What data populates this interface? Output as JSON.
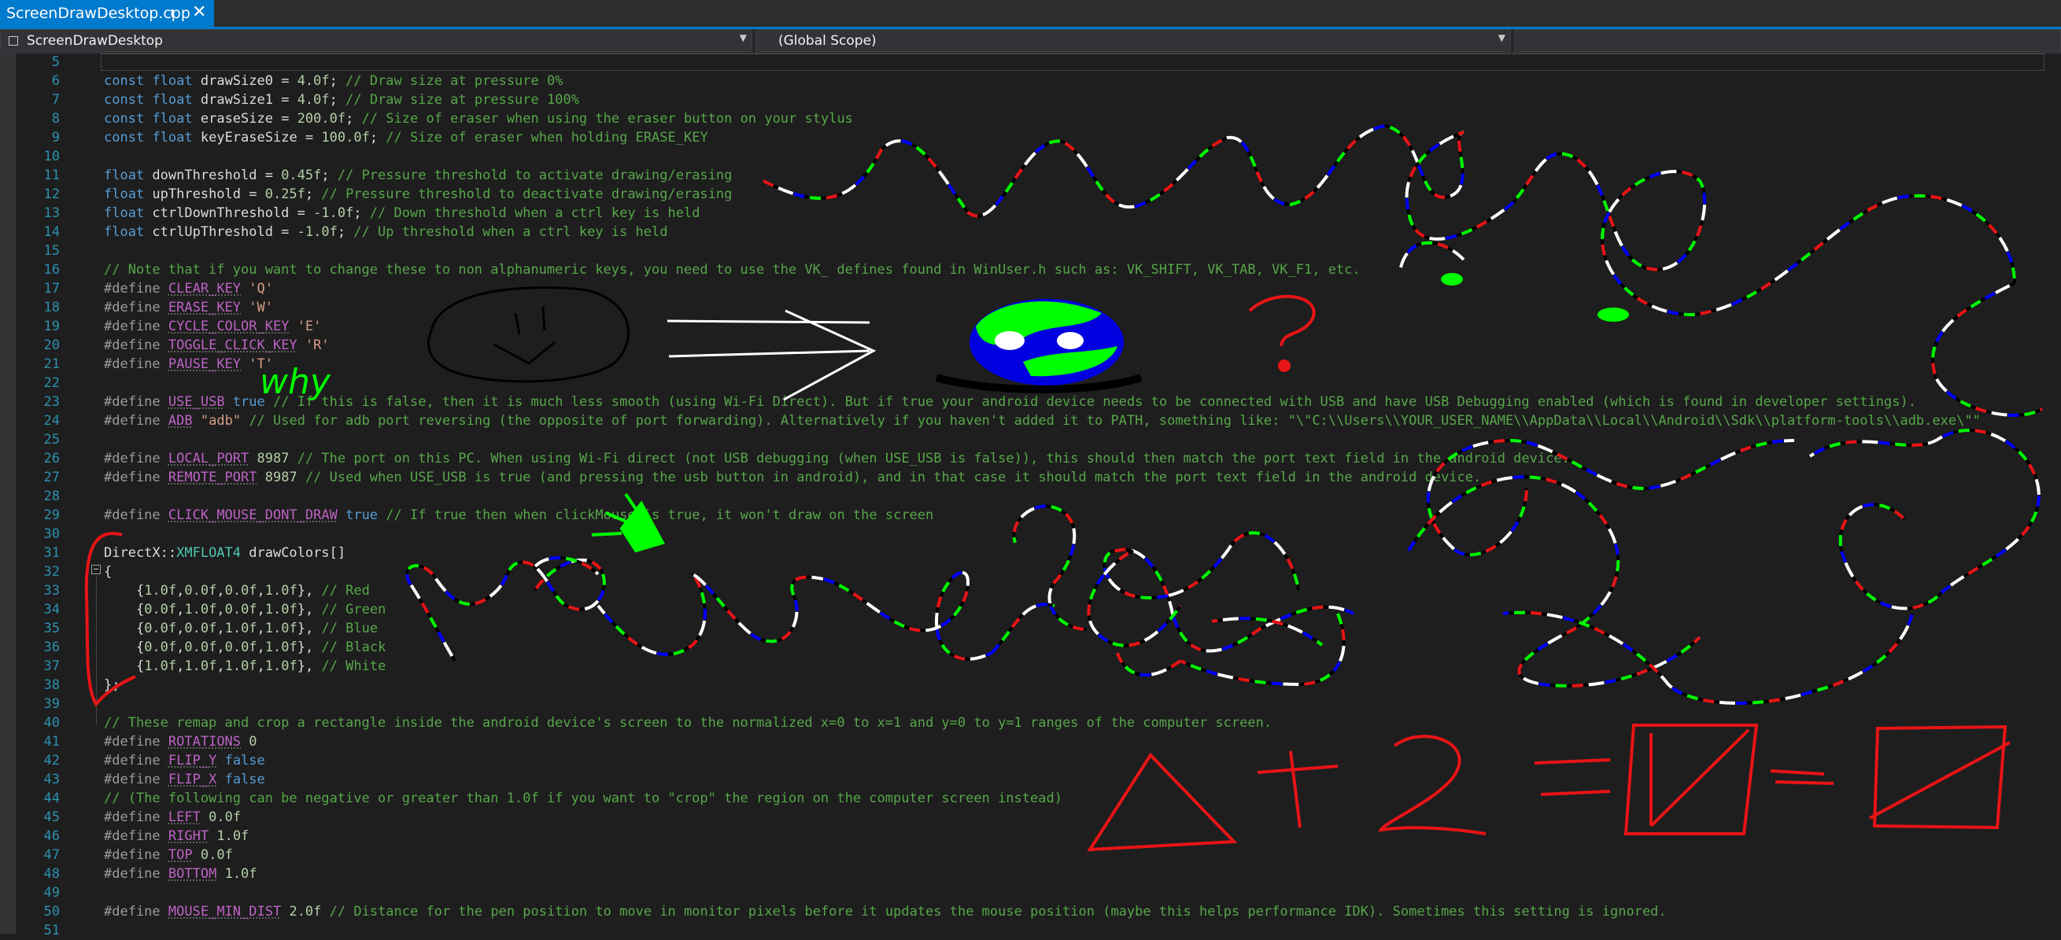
{
  "tab": {
    "title": "ScreenDrawDesktop.cpp",
    "pin_icon": "pin-icon",
    "close_icon": "close-icon"
  },
  "nav": {
    "project": "ScreenDrawDesktop",
    "scope": "(Global Scope)"
  },
  "editor": {
    "lines": [
      {
        "n": "5",
        "segs": []
      },
      {
        "n": "6",
        "segs": [
          [
            "kw",
            "const"
          ],
          [
            "tx",
            " "
          ],
          [
            "kw",
            "float"
          ],
          [
            "tx",
            " drawSize0 = "
          ],
          [
            "nm",
            "4.0f"
          ],
          [
            "tx",
            "; "
          ],
          [
            "cm",
            "// Draw size at pressure 0%"
          ]
        ]
      },
      {
        "n": "7",
        "segs": [
          [
            "kw",
            "const"
          ],
          [
            "tx",
            " "
          ],
          [
            "kw",
            "float"
          ],
          [
            "tx",
            " drawSize1 = "
          ],
          [
            "nm",
            "4.0f"
          ],
          [
            "tx",
            "; "
          ],
          [
            "cm",
            "// Draw size at pressure 100%"
          ]
        ]
      },
      {
        "n": "8",
        "segs": [
          [
            "kw",
            "const"
          ],
          [
            "tx",
            " "
          ],
          [
            "kw",
            "float"
          ],
          [
            "tx",
            " eraseSize = "
          ],
          [
            "nm",
            "200.0f"
          ],
          [
            "tx",
            "; "
          ],
          [
            "cm",
            "// Size of eraser when using the eraser button on your stylus"
          ]
        ]
      },
      {
        "n": "9",
        "segs": [
          [
            "kw",
            "const"
          ],
          [
            "tx",
            " "
          ],
          [
            "kw",
            "float"
          ],
          [
            "tx",
            " keyEraseSize = "
          ],
          [
            "nm",
            "100.0f"
          ],
          [
            "tx",
            "; "
          ],
          [
            "cm",
            "// Size of eraser when holding ERASE_KEY"
          ]
        ]
      },
      {
        "n": "10",
        "segs": []
      },
      {
        "n": "11",
        "segs": [
          [
            "kw",
            "float"
          ],
          [
            "tx",
            " downThreshold = "
          ],
          [
            "nm",
            "0.45f"
          ],
          [
            "tx",
            "; "
          ],
          [
            "cm",
            "// Pressure threshold to activate drawing/erasing"
          ]
        ]
      },
      {
        "n": "12",
        "segs": [
          [
            "kw",
            "float"
          ],
          [
            "tx",
            " upThreshold = "
          ],
          [
            "nm",
            "0.25f"
          ],
          [
            "tx",
            "; "
          ],
          [
            "cm",
            "// Pressure threshold to deactivate drawing/erasing"
          ]
        ]
      },
      {
        "n": "13",
        "segs": [
          [
            "kw",
            "float"
          ],
          [
            "tx",
            " ctrlDownThreshold = "
          ],
          [
            "nm",
            "-1.0f"
          ],
          [
            "tx",
            "; "
          ],
          [
            "cm",
            "// Down threshold when a ctrl key is held"
          ]
        ]
      },
      {
        "n": "14",
        "segs": [
          [
            "kw",
            "float"
          ],
          [
            "tx",
            " ctrlUpThreshold = "
          ],
          [
            "nm",
            "-1.0f"
          ],
          [
            "tx",
            "; "
          ],
          [
            "cm",
            "// Up threshold when a ctrl key is held"
          ]
        ]
      },
      {
        "n": "15",
        "segs": []
      },
      {
        "n": "16",
        "segs": [
          [
            "cm",
            "// Note that if you want to change these to non alphanumeric keys, you need to use the VK_ defines found in WinUser.h such as: VK_SHIFT, VK_TAB, VK_F1, etc."
          ]
        ]
      },
      {
        "n": "17",
        "segs": [
          [
            "pp",
            "#define"
          ],
          [
            "tx",
            " "
          ],
          [
            "mac",
            "CLEAR_KEY"
          ],
          [
            "tx",
            " "
          ],
          [
            "st",
            "'Q'"
          ]
        ]
      },
      {
        "n": "18",
        "segs": [
          [
            "pp",
            "#define"
          ],
          [
            "tx",
            " "
          ],
          [
            "mac",
            "ERASE_KEY"
          ],
          [
            "tx",
            " "
          ],
          [
            "st",
            "'W'"
          ]
        ]
      },
      {
        "n": "19",
        "segs": [
          [
            "pp",
            "#define"
          ],
          [
            "tx",
            " "
          ],
          [
            "mac",
            "CYCLE_COLOR_KEY"
          ],
          [
            "tx",
            " "
          ],
          [
            "st",
            "'E'"
          ]
        ]
      },
      {
        "n": "20",
        "segs": [
          [
            "pp",
            "#define"
          ],
          [
            "tx",
            " "
          ],
          [
            "mac",
            "TOGGLE_CLICK_KEY"
          ],
          [
            "tx",
            " "
          ],
          [
            "st",
            "'R'"
          ]
        ]
      },
      {
        "n": "21",
        "segs": [
          [
            "pp",
            "#define"
          ],
          [
            "tx",
            " "
          ],
          [
            "mac",
            "PAUSE_KEY"
          ],
          [
            "tx",
            " "
          ],
          [
            "st",
            "'T'"
          ]
        ]
      },
      {
        "n": "22",
        "segs": []
      },
      {
        "n": "23",
        "segs": [
          [
            "pp",
            "#define"
          ],
          [
            "tx",
            " "
          ],
          [
            "mac",
            "USE_USB"
          ],
          [
            "tx",
            " "
          ],
          [
            "kw",
            "true"
          ],
          [
            "tx",
            " "
          ],
          [
            "cm",
            "// If this is false, then it is much less smooth (using Wi-Fi Direct). But if true your android device needs to be connected with USB and have USB Debugging enabled (which is found in developer settings)."
          ]
        ]
      },
      {
        "n": "24",
        "segs": [
          [
            "pp",
            "#define"
          ],
          [
            "tx",
            " "
          ],
          [
            "mac",
            "ADB"
          ],
          [
            "tx",
            " "
          ],
          [
            "st",
            "\"adb\""
          ],
          [
            "tx",
            " "
          ],
          [
            "cm",
            "// Used for adb port reversing (the opposite of port forwarding). Alternatively if you haven't added it to PATH, something like: \"\\\"C:\\\\Users\\\\YOUR_USER_NAME\\\\AppData\\\\Local\\\\Android\\\\Sdk\\\\platform-tools\\\\adb.exe\\\"\""
          ]
        ]
      },
      {
        "n": "25",
        "segs": []
      },
      {
        "n": "26",
        "segs": [
          [
            "pp",
            "#define"
          ],
          [
            "tx",
            " "
          ],
          [
            "mac",
            "LOCAL_PORT"
          ],
          [
            "tx",
            " "
          ],
          [
            "nm",
            "8987"
          ],
          [
            "tx",
            " "
          ],
          [
            "cm",
            "// The port on this PC. When using Wi-Fi direct (not USB debugging (when USE_USB is false)), this should then match the port text field in the android device."
          ]
        ]
      },
      {
        "n": "27",
        "segs": [
          [
            "pp",
            "#define"
          ],
          [
            "tx",
            " "
          ],
          [
            "mac",
            "REMOTE_PORT"
          ],
          [
            "tx",
            " "
          ],
          [
            "nm",
            "8987"
          ],
          [
            "tx",
            " "
          ],
          [
            "cm",
            "// Used when USE_USB is true (and pressing the usb button in android), and in that case it should match the port text field in the android device."
          ]
        ]
      },
      {
        "n": "28",
        "segs": []
      },
      {
        "n": "29",
        "segs": [
          [
            "pp",
            "#define"
          ],
          [
            "tx",
            " "
          ],
          [
            "mac",
            "CLICK_MOUSE_DONT_DRAW"
          ],
          [
            "tx",
            " "
          ],
          [
            "kw",
            "true"
          ],
          [
            "tx",
            " "
          ],
          [
            "cm",
            "// If true then when clickMouse is true, it won't draw on the screen"
          ]
        ]
      },
      {
        "n": "30",
        "segs": []
      },
      {
        "n": "31",
        "segs": [
          [
            "tx",
            "DirectX::"
          ],
          [
            "ty",
            "XMFLOAT4"
          ],
          [
            "tx",
            " drawColors[]"
          ]
        ]
      },
      {
        "n": "32",
        "segs": [
          [
            "tx",
            "{"
          ]
        ]
      },
      {
        "n": "33",
        "segs": [
          [
            "tx",
            "    {"
          ],
          [
            "nm",
            "1.0f"
          ],
          [
            "tx",
            ","
          ],
          [
            "nm",
            "0.0f"
          ],
          [
            "tx",
            ","
          ],
          [
            "nm",
            "0.0f"
          ],
          [
            "tx",
            ","
          ],
          [
            "nm",
            "1.0f"
          ],
          [
            "tx",
            "}, "
          ],
          [
            "cm",
            "// Red"
          ]
        ]
      },
      {
        "n": "34",
        "segs": [
          [
            "tx",
            "    {"
          ],
          [
            "nm",
            "0.0f"
          ],
          [
            "tx",
            ","
          ],
          [
            "nm",
            "1.0f"
          ],
          [
            "tx",
            ","
          ],
          [
            "nm",
            "0.0f"
          ],
          [
            "tx",
            ","
          ],
          [
            "nm",
            "1.0f"
          ],
          [
            "tx",
            "}, "
          ],
          [
            "cm",
            "// Green"
          ]
        ]
      },
      {
        "n": "35",
        "segs": [
          [
            "tx",
            "    {"
          ],
          [
            "nm",
            "0.0f"
          ],
          [
            "tx",
            ","
          ],
          [
            "nm",
            "0.0f"
          ],
          [
            "tx",
            ","
          ],
          [
            "nm",
            "1.0f"
          ],
          [
            "tx",
            ","
          ],
          [
            "nm",
            "1.0f"
          ],
          [
            "tx",
            "}, "
          ],
          [
            "cm",
            "// Blue"
          ]
        ]
      },
      {
        "n": "36",
        "segs": [
          [
            "tx",
            "    {"
          ],
          [
            "nm",
            "0.0f"
          ],
          [
            "tx",
            ","
          ],
          [
            "nm",
            "0.0f"
          ],
          [
            "tx",
            ","
          ],
          [
            "nm",
            "0.0f"
          ],
          [
            "tx",
            ","
          ],
          [
            "nm",
            "1.0f"
          ],
          [
            "tx",
            "}, "
          ],
          [
            "cm",
            "// Black"
          ]
        ]
      },
      {
        "n": "37",
        "segs": [
          [
            "tx",
            "    {"
          ],
          [
            "nm",
            "1.0f"
          ],
          [
            "tx",
            ","
          ],
          [
            "nm",
            "1.0f"
          ],
          [
            "tx",
            ","
          ],
          [
            "nm",
            "1.0f"
          ],
          [
            "tx",
            ","
          ],
          [
            "nm",
            "1.0f"
          ],
          [
            "tx",
            "}, "
          ],
          [
            "cm",
            "// White"
          ]
        ]
      },
      {
        "n": "38",
        "segs": [
          [
            "tx",
            "};"
          ]
        ]
      },
      {
        "n": "39",
        "segs": []
      },
      {
        "n": "40",
        "segs": [
          [
            "cm",
            "// These remap and crop a rectangle inside the android device's screen to the normalized x=0 to x=1 and y=0 to y=1 ranges of the computer screen."
          ]
        ]
      },
      {
        "n": "41",
        "segs": [
          [
            "pp",
            "#define"
          ],
          [
            "tx",
            " "
          ],
          [
            "mac",
            "ROTATIONS"
          ],
          [
            "tx",
            " "
          ],
          [
            "nm",
            "0"
          ]
        ]
      },
      {
        "n": "42",
        "segs": [
          [
            "pp",
            "#define"
          ],
          [
            "tx",
            " "
          ],
          [
            "mac",
            "FLIP_Y"
          ],
          [
            "tx",
            " "
          ],
          [
            "kw",
            "false"
          ]
        ]
      },
      {
        "n": "43",
        "segs": [
          [
            "pp",
            "#define"
          ],
          [
            "tx",
            " "
          ],
          [
            "mac",
            "FLIP_X"
          ],
          [
            "tx",
            " "
          ],
          [
            "kw",
            "false"
          ]
        ]
      },
      {
        "n": "44",
        "segs": [
          [
            "cm",
            "// (The following can be negative or greater than 1.0f if you want to \"crop\" the region on the computer screen instead)"
          ]
        ]
      },
      {
        "n": "45",
        "segs": [
          [
            "pp",
            "#define"
          ],
          [
            "tx",
            " "
          ],
          [
            "mac",
            "LEFT"
          ],
          [
            "tx",
            " "
          ],
          [
            "nm",
            "0.0f"
          ]
        ]
      },
      {
        "n": "46",
        "segs": [
          [
            "pp",
            "#define"
          ],
          [
            "tx",
            " "
          ],
          [
            "mac",
            "RIGHT"
          ],
          [
            "tx",
            " "
          ],
          [
            "nm",
            "1.0f"
          ]
        ]
      },
      {
        "n": "47",
        "segs": [
          [
            "pp",
            "#define"
          ],
          [
            "tx",
            " "
          ],
          [
            "mac",
            "TOP"
          ],
          [
            "tx",
            " "
          ],
          [
            "nm",
            "0.0f"
          ]
        ]
      },
      {
        "n": "48",
        "segs": [
          [
            "pp",
            "#define"
          ],
          [
            "tx",
            " "
          ],
          [
            "mac",
            "BOTTOM"
          ],
          [
            "tx",
            " "
          ],
          [
            "nm",
            "1.0f"
          ]
        ]
      },
      {
        "n": "49",
        "segs": []
      },
      {
        "n": "50",
        "segs": [
          [
            "pp",
            "#define"
          ],
          [
            "tx",
            " "
          ],
          [
            "mac",
            "MOUSE_MIN_DIST"
          ],
          [
            "tx",
            " "
          ],
          [
            "nm",
            "2.0f"
          ],
          [
            "tx",
            " "
          ],
          [
            "cm",
            "// Distance for the pen position to move in monitor pixels before it updates the mouse position (maybe this helps performance IDK). Sometimes this setting is ignored."
          ]
        ]
      },
      {
        "n": "51",
        "segs": []
      }
    ]
  },
  "drawings": [
    {
      "name": "smiley-face-sketch"
    },
    {
      "name": "arrow-sketch"
    },
    {
      "name": "earth-face-sketch"
    },
    {
      "name": "question-mark-sketch"
    },
    {
      "name": "why-handwriting"
    },
    {
      "name": "multicolor-squiggle-lines"
    },
    {
      "name": "triangle-plus-two-equals-box-equation-sketch"
    },
    {
      "name": "red-bracket-sketch"
    },
    {
      "name": "green-pen-cursor-sketch"
    }
  ],
  "handwriting": {
    "why": "why"
  },
  "colors": {
    "accent": "#007acc",
    "keyword": "#569cd6",
    "comment": "#57a64a",
    "string": "#d69d85",
    "macro": "#bd63c5",
    "type": "#4ec9b0",
    "number": "#b5cea8",
    "line_number": "#2b91af",
    "pen": [
      "#e81416",
      "#00ff00",
      "#0000ff",
      "#000000",
      "#ffffff"
    ]
  }
}
